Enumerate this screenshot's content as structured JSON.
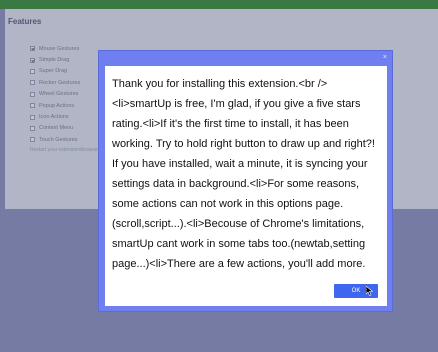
{
  "background": {
    "section_title": "Features",
    "features": [
      {
        "label": "Mouse Gestures",
        "checked": true
      },
      {
        "label": "Simple Drag",
        "checked": true
      },
      {
        "label": "Super Drag",
        "checked": false
      },
      {
        "label": "Rocker Gestures",
        "checked": false
      },
      {
        "label": "Wheel Gestures",
        "checked": false
      },
      {
        "label": "Popup Actions",
        "checked": false
      },
      {
        "label": "Icon Actions",
        "checked": false
      },
      {
        "label": "Context Menu",
        "checked": false
      },
      {
        "label": "Touch Gestures",
        "checked": false
      }
    ],
    "footer_note": "Restart your extension/browser for the changes to take effect"
  },
  "dialog": {
    "close_label": "×",
    "message": "Thank you for installing this extension.<br /><li>smartUp is free, I'm glad, if you give a five stars rating.<li>If it's the first time to install, it has been working. Try to hold right button to draw up and right?! If you have installed, wait a minute, it is syncing your settings data in background.<li>For some reasons, some actions can not work in this options page.(scroll,script...).<li>Becouse of Chrome's limitations, smartUp cant work in some tabs too.(newtab,setting page...)<li>There are a few actions, you'll add more.",
    "ok_label": "OK"
  },
  "colors": {
    "dialog_frame": "#6f7ff0",
    "ok_button": "#3f66ee",
    "top_bar": "#2e8a1e"
  }
}
